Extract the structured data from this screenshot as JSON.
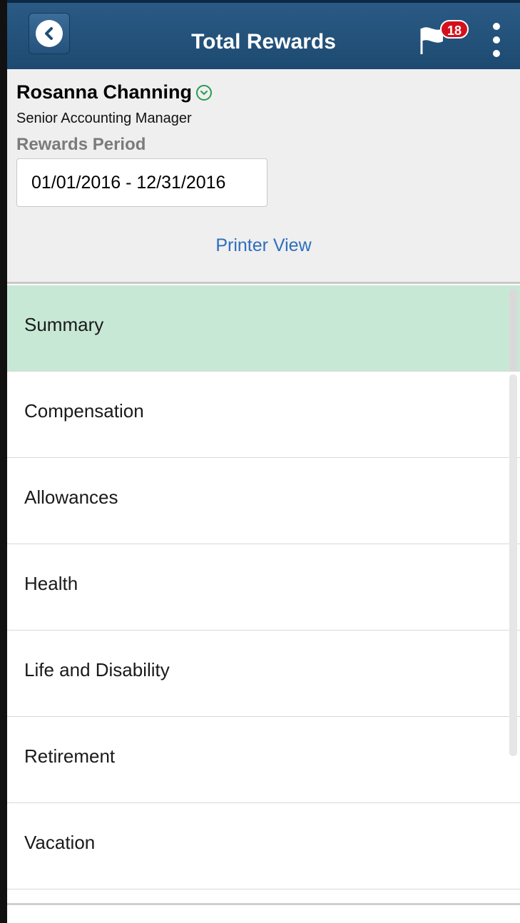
{
  "header": {
    "title": "Total Rewards",
    "notification_count": "18",
    "icons": [
      "back-icon",
      "flag-icon",
      "kebab-menu-icon"
    ],
    "bar_color": "#1f4d75"
  },
  "employee": {
    "name": "Rosanna Channing",
    "job_title": "Senior Accounting Manager",
    "rewards_period_label": "Rewards Period",
    "rewards_period_value": "01/01/2016  - 12/31/2016"
  },
  "actions": {
    "printer_view": "Printer View"
  },
  "nav": {
    "items": [
      {
        "label": "Summary",
        "selected": true
      },
      {
        "label": "Compensation",
        "selected": false
      },
      {
        "label": "Allowances",
        "selected": false
      },
      {
        "label": "Health",
        "selected": false
      },
      {
        "label": "Life and Disability",
        "selected": false
      },
      {
        "label": "Retirement",
        "selected": false
      },
      {
        "label": "Vacation",
        "selected": false
      }
    ],
    "selected_color": "#c8e8d6"
  }
}
